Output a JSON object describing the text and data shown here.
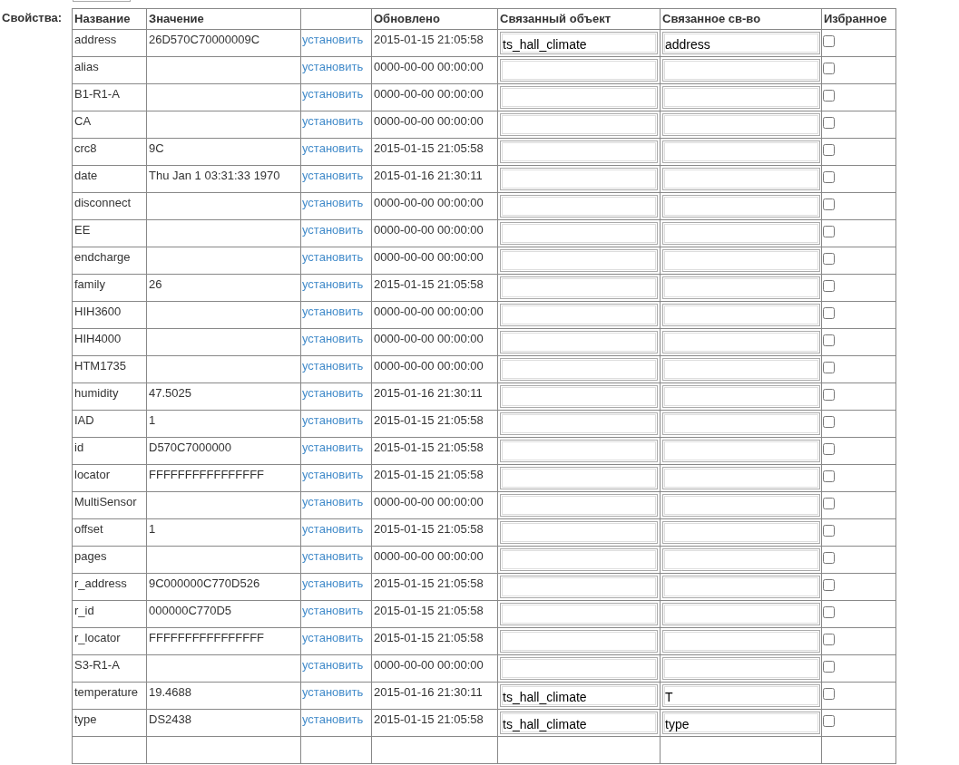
{
  "section_label": "Свойства:",
  "columns": [
    "Название",
    "Значение",
    "",
    "Обновлено",
    "Связанный объект",
    "Связанное св-во",
    "Избранное"
  ],
  "rows": [
    {
      "name": "address",
      "value": "26D570C70000009C",
      "action": "установить",
      "updated": "2015-01-15 21:05:58",
      "linked_object": "ts_hall_climate",
      "linked_property": "address",
      "favorite": false
    },
    {
      "name": "alias",
      "value": "",
      "action": "установить",
      "updated": "0000-00-00 00:00:00",
      "linked_object": "",
      "linked_property": "",
      "favorite": false
    },
    {
      "name": "B1-R1-A",
      "value": "",
      "action": "установить",
      "updated": "0000-00-00 00:00:00",
      "linked_object": "",
      "linked_property": "",
      "favorite": false
    },
    {
      "name": "CA",
      "value": "",
      "action": "установить",
      "updated": "0000-00-00 00:00:00",
      "linked_object": "",
      "linked_property": "",
      "favorite": false
    },
    {
      "name": "crc8",
      "value": "9C",
      "action": "установить",
      "updated": "2015-01-15 21:05:58",
      "linked_object": "",
      "linked_property": "",
      "favorite": false
    },
    {
      "name": "date",
      "value": "Thu Jan 1 03:31:33 1970",
      "action": "установить",
      "updated": "2015-01-16 21:30:11",
      "linked_object": "",
      "linked_property": "",
      "favorite": false
    },
    {
      "name": "disconnect",
      "value": "",
      "action": "установить",
      "updated": "0000-00-00 00:00:00",
      "linked_object": "",
      "linked_property": "",
      "favorite": false
    },
    {
      "name": "EE",
      "value": "",
      "action": "установить",
      "updated": "0000-00-00 00:00:00",
      "linked_object": "",
      "linked_property": "",
      "favorite": false
    },
    {
      "name": "endcharge",
      "value": "",
      "action": "установить",
      "updated": "0000-00-00 00:00:00",
      "linked_object": "",
      "linked_property": "",
      "favorite": false
    },
    {
      "name": "family",
      "value": "26",
      "action": "установить",
      "updated": "2015-01-15 21:05:58",
      "linked_object": "",
      "linked_property": "",
      "favorite": false
    },
    {
      "name": "HIH3600",
      "value": "",
      "action": "установить",
      "updated": "0000-00-00 00:00:00",
      "linked_object": "",
      "linked_property": "",
      "favorite": false
    },
    {
      "name": "HIH4000",
      "value": "",
      "action": "установить",
      "updated": "0000-00-00 00:00:00",
      "linked_object": "",
      "linked_property": "",
      "favorite": false
    },
    {
      "name": "HTM1735",
      "value": "",
      "action": "установить",
      "updated": "0000-00-00 00:00:00",
      "linked_object": "",
      "linked_property": "",
      "favorite": false
    },
    {
      "name": "humidity",
      "value": "47.5025",
      "action": "установить",
      "updated": "2015-01-16 21:30:11",
      "linked_object": "",
      "linked_property": "",
      "favorite": false
    },
    {
      "name": "IAD",
      "value": "1",
      "action": "установить",
      "updated": "2015-01-15 21:05:58",
      "linked_object": "",
      "linked_property": "",
      "favorite": false
    },
    {
      "name": "id",
      "value": "D570C7000000",
      "action": "установить",
      "updated": "2015-01-15 21:05:58",
      "linked_object": "",
      "linked_property": "",
      "favorite": false
    },
    {
      "name": "locator",
      "value": "FFFFFFFFFFFFFFFF",
      "action": "установить",
      "updated": "2015-01-15 21:05:58",
      "linked_object": "",
      "linked_property": "",
      "favorite": false
    },
    {
      "name": "MultiSensor",
      "value": "",
      "action": "установить",
      "updated": "0000-00-00 00:00:00",
      "linked_object": "",
      "linked_property": "",
      "favorite": false
    },
    {
      "name": "offset",
      "value": "1",
      "action": "установить",
      "updated": "2015-01-15 21:05:58",
      "linked_object": "",
      "linked_property": "",
      "favorite": false
    },
    {
      "name": "pages",
      "value": "",
      "action": "установить",
      "updated": "0000-00-00 00:00:00",
      "linked_object": "",
      "linked_property": "",
      "favorite": false
    },
    {
      "name": "r_address",
      "value": "9C000000C770D526",
      "action": "установить",
      "updated": "2015-01-15 21:05:58",
      "linked_object": "",
      "linked_property": "",
      "favorite": false
    },
    {
      "name": "r_id",
      "value": "000000C770D5",
      "action": "установить",
      "updated": "2015-01-15 21:05:58",
      "linked_object": "",
      "linked_property": "",
      "favorite": false
    },
    {
      "name": "r_locator",
      "value": "FFFFFFFFFFFFFFFF",
      "action": "установить",
      "updated": "2015-01-15 21:05:58",
      "linked_object": "",
      "linked_property": "",
      "favorite": false
    },
    {
      "name": "S3-R1-A",
      "value": "",
      "action": "установить",
      "updated": "0000-00-00 00:00:00",
      "linked_object": "",
      "linked_property": "",
      "favorite": false
    },
    {
      "name": "temperature",
      "value": "19.4688",
      "action": "установить",
      "updated": "2015-01-16 21:30:11",
      "linked_object": "ts_hall_climate",
      "linked_property": "T",
      "favorite": false
    },
    {
      "name": "type",
      "value": "DS2438",
      "action": "установить",
      "updated": "2015-01-15 21:05:58",
      "linked_object": "ts_hall_climate",
      "linked_property": "type",
      "favorite": false
    }
  ]
}
